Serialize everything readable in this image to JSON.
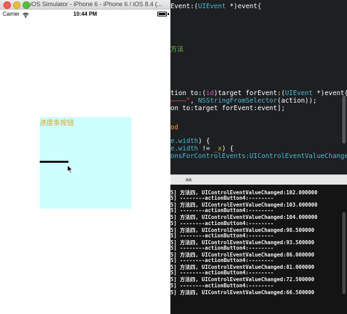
{
  "simulator": {
    "title": "iOS Simulator - iPhone 6 - iPhone 6 / iOS 8.4 (...",
    "status_bar": {
      "carrier": "Carrier",
      "time": "10:44 PM"
    },
    "slider_label": "进度条按钮"
  },
  "editor": {
    "lines": [
      {
        "segments": [
          {
            "t": "Event:(",
            "c": "white"
          },
          {
            "t": "UIEvent",
            "c": "cyan"
          },
          {
            "t": " *)event{",
            "c": "white"
          }
        ]
      },
      {
        "segments": [
          {
            "t": "方法",
            "c": "green"
          }
        ]
      },
      {
        "segments": [
          {
            "t": "tion to:(",
            "c": "white"
          },
          {
            "t": "id",
            "c": "pink"
          },
          {
            "t": ")target forEvent:(",
            "c": "white"
          },
          {
            "t": "UIEvent",
            "c": "cyan"
          },
          {
            "t": " *)event{",
            "c": "white"
          }
        ]
      },
      {
        "segments": [
          {
            "t": "————\"",
            "c": "red"
          },
          {
            "t": ", ",
            "c": "white"
          },
          {
            "t": "NSStringFromSelector",
            "c": "cyan"
          },
          {
            "t": "(action));",
            "c": "white"
          }
        ]
      },
      {
        "segments": [
          {
            "t": "on to:target forEvent:event];",
            "c": "white"
          }
        ]
      },
      {
        "segments": [
          {
            "t": "od",
            "c": "orange"
          }
        ]
      },
      {
        "segments": [
          {
            "t": "e.width",
            "c": "cyan"
          },
          {
            "t": ") {",
            "c": "white"
          }
        ]
      },
      {
        "segments": [
          {
            "t": "e.width",
            "c": "cyan"
          },
          {
            "t": " != ",
            "c": "white"
          },
          {
            "t": "_x",
            "c": "yellow"
          },
          {
            "t": ") {",
            "c": "white"
          }
        ]
      },
      {
        "segments": [
          {
            "t": "onsForControlEvents:UIControlEventValueChanged",
            "c": "cyan"
          }
        ]
      }
    ]
  },
  "debug_bar": {
    "filter_text": "aa"
  },
  "console": {
    "lines": [
      "5] 方法四, UIControlEventValueChanged:102.000000",
      "5] --------actionButton4:--------",
      "5] 方法四, UIControlEventValueChanged:103.000000",
      "5] --------actionButton4:--------",
      "5] 方法四, UIControlEventValueChanged:104.000000",
      "5] --------actionButton4:--------",
      "5] 方法四, UIControlEventValueChanged:98.500000",
      "5] --------actionButton4:--------",
      "5] 方法四, UIControlEventValueChanged:93.500000",
      "5] --------actionButton4:--------",
      "5] 方法四, UIControlEventValueChanged:86.000000",
      "5] --------actionButton4:--------",
      "5] 方法四, UIControlEventValueChanged:81.000000",
      "5] --------actionButton4:--------",
      "5] 方法四, UIControlEventValueChanged:72.500000",
      "5] --------actionButton4:--------",
      "5] 方法四, UIControlEventValueChanged:66.500000"
    ]
  },
  "colors": {
    "panel_background": "#ccfffe",
    "label": "#e0a020",
    "editor_background": "#1d1f21",
    "console_background": "#141414"
  },
  "icons": {
    "title_bar": [
      "close-button",
      "minimize-button",
      "zoom-button"
    ],
    "status_bar": [
      "wifi-icon",
      "battery-icon"
    ],
    "pointer": "cursor-icon"
  }
}
